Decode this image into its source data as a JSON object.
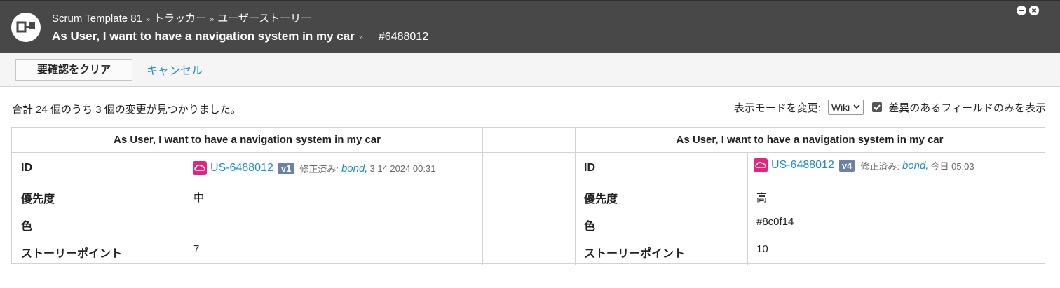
{
  "header": {
    "breadcrumbs": [
      "Scrum Template 81",
      "トラッカー",
      "ユーザーストーリー"
    ],
    "title": "As User, I want to have a navigation system in my car",
    "item_number": "#6488012"
  },
  "toolbar": {
    "clear_label": "要確認をクリア",
    "cancel_label": "キャンセル"
  },
  "summary": "合計 24 個のうち 3 個の変更が見つかりました。",
  "view_mode": {
    "label": "表示モードを変更:",
    "selected": "Wiki",
    "only_diff_label": "差異のあるフィールドのみを表示",
    "only_diff_checked": true
  },
  "left": {
    "title": "As User, I want to have a navigation system in my car",
    "id": "US-6488012",
    "version": "v1",
    "modified_label": "修正済み:",
    "user": "bond,",
    "date": "3 14 2024 00:31",
    "fields": [
      {
        "label": "ID"
      },
      {
        "label": "優先度",
        "value": "中"
      },
      {
        "label": "色",
        "value": ""
      },
      {
        "label": "ストーリーポイント",
        "value": "7"
      }
    ]
  },
  "right": {
    "title": "As User, I want to have a navigation system in my car",
    "id": "US-6488012",
    "version": "v4",
    "modified_label": "修正済み:",
    "user": "bond,",
    "date": "今日 05:03",
    "fields": [
      {
        "label": "ID"
      },
      {
        "label": "優先度",
        "value": "高"
      },
      {
        "label": "色",
        "value": "#8c0f14"
      },
      {
        "label": "ストーリーポイント",
        "value": "10"
      }
    ]
  },
  "colors": {
    "header_bg": "#484848",
    "link": "#1f8dc4",
    "badge": "#e0267c",
    "version_badge": "#6a81a8"
  }
}
